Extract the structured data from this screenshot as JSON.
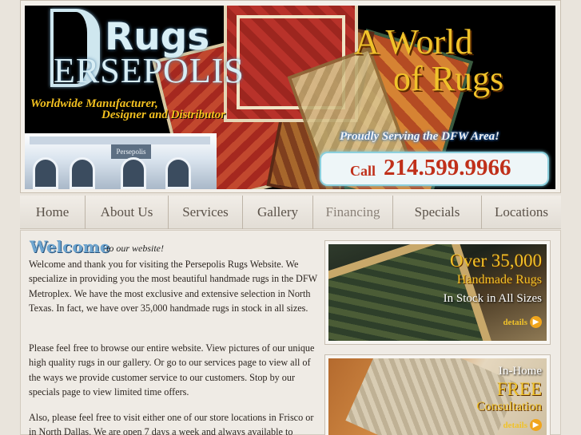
{
  "banner": {
    "logo_rugs": "Rugs",
    "logo_name": "ERSEPOLIS",
    "tagline_line1": "Worldwide Manufacturer,",
    "tagline_line2": "Designer and Distributor",
    "storefront_sign": "Persepolis Rugs",
    "headline_line1": "A World",
    "headline_line2": "of Rugs",
    "serving": "Proudly Serving the DFW Area!",
    "call_label": "Call",
    "phone": "214.599.9966"
  },
  "nav": {
    "items": [
      {
        "label": "Home"
      },
      {
        "label": "About Us"
      },
      {
        "label": "Services"
      },
      {
        "label": "Gallery"
      },
      {
        "label": "Financing"
      },
      {
        "label": "Specials"
      },
      {
        "label": "Locations"
      }
    ]
  },
  "welcome": {
    "title": "Welcome",
    "subtitle": "to our website!",
    "paragraphs": [
      "Welcome and thank you for visiting the Persepolis Rugs Website. We specialize in providing you the most beautiful handmade rugs in the DFW Metroplex. We have the most exclusive and extensive selection in North Texas. In fact, we have over 35,000 handmade rugs in stock in all sizes.",
      "Please feel free to browse our entire website. View pictures of our unique high quality rugs in our gallery. Or go to our services page to view all of the ways we provide customer service to our customers. Stop by our specials page to view limited time offers.",
      "Also, please feel free to visit either one of our store locations in Frisco or in North Dallas. We are open 7 days a week and always available to"
    ]
  },
  "promos": [
    {
      "line1": "Over 35,000",
      "line2": "Handmade Rugs",
      "line3": "In Stock in All Sizes",
      "details": "details"
    },
    {
      "line1": "In-Home",
      "line2": "FREE",
      "line3": "Consultation",
      "details": "details"
    }
  ],
  "colors": {
    "gold": "#f0c22a",
    "phone_red": "#c0301a",
    "welcome_blue": "#6ea5cf"
  }
}
